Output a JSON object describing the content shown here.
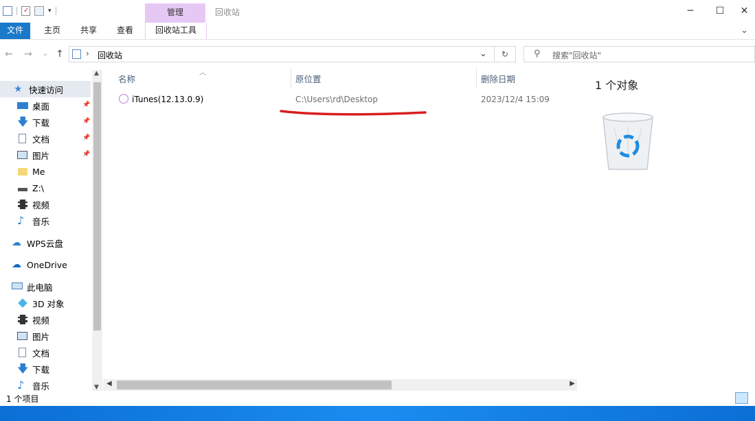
{
  "window": {
    "title": "回收站",
    "context_tab": "管理",
    "minimize": "─",
    "maximize": "☐",
    "close": "✕"
  },
  "ribbon": {
    "tabs": [
      "文件",
      "主页",
      "共享",
      "查看"
    ],
    "tools_tab": "回收站工具",
    "expand": "⌄"
  },
  "address": {
    "path": "回收站",
    "separator": "›",
    "dropdown": "⌄",
    "refresh": "↻",
    "back": "←",
    "forward": "→",
    "recent": "⌄",
    "up": "↑"
  },
  "search": {
    "placeholder": "搜索\"回收站\""
  },
  "nav": {
    "quick_access": "快速访问",
    "items": [
      {
        "label": "桌面",
        "pinned": true
      },
      {
        "label": "下载",
        "pinned": true
      },
      {
        "label": "文档",
        "pinned": true
      },
      {
        "label": "图片",
        "pinned": true
      },
      {
        "label": "Me",
        "pinned": false
      },
      {
        "label": "Z:\\",
        "pinned": false
      },
      {
        "label": "视频",
        "pinned": false
      },
      {
        "label": "音乐",
        "pinned": false
      }
    ],
    "wps": "WPS云盘",
    "onedrive": "OneDrive",
    "this_pc": "此电脑",
    "pc_items": [
      "3D 对象",
      "视频",
      "图片",
      "文档",
      "下载",
      "音乐"
    ]
  },
  "columns": {
    "name": "名称",
    "original_location": "原位置",
    "date_deleted": "删除日期"
  },
  "files": [
    {
      "name": "iTunes(12.13.0.9)",
      "original_location": "C:\\Users\\rd\\Desktop",
      "date_deleted": "2023/12/4 15:09"
    }
  ],
  "preview": {
    "count_label": "1 个对象"
  },
  "status": {
    "item_count": "1 个项目"
  },
  "colors": {
    "accent": "#1979ca",
    "context_tab": "#e6c8f5",
    "annotation_red": "#d81e1e",
    "selected": "#cce8ff"
  }
}
